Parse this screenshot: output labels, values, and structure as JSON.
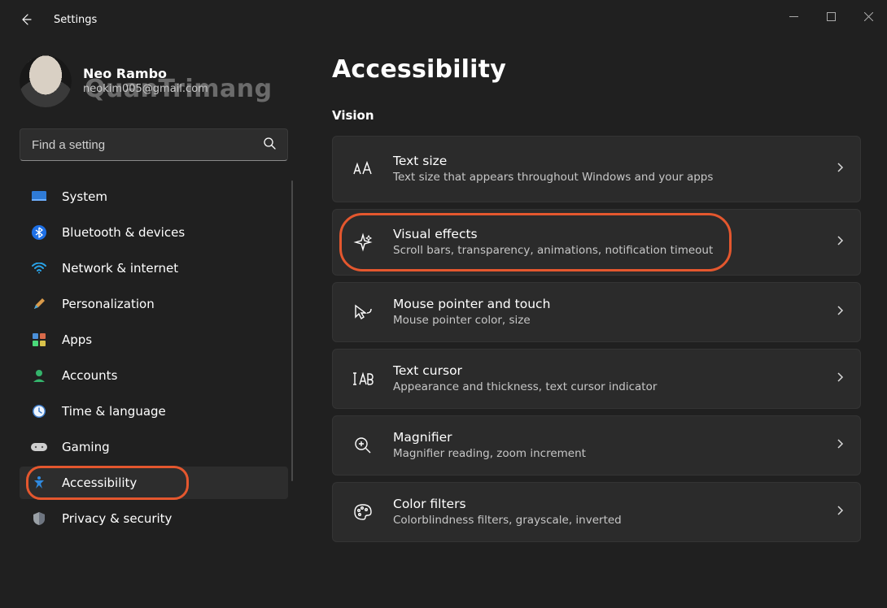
{
  "titlebar": {
    "app_title": "Settings"
  },
  "profile": {
    "name": "Neo Rambo",
    "email": "neokim005@gmail.com"
  },
  "watermark": "QuanTrimang",
  "search": {
    "placeholder": "Find a setting"
  },
  "sidebar": {
    "items": [
      {
        "icon": "monitor",
        "label": "System"
      },
      {
        "icon": "bluetooth",
        "label": "Bluetooth & devices"
      },
      {
        "icon": "wifi",
        "label": "Network & internet"
      },
      {
        "icon": "brush",
        "label": "Personalization"
      },
      {
        "icon": "apps",
        "label": "Apps"
      },
      {
        "icon": "person",
        "label": "Accounts"
      },
      {
        "icon": "clock",
        "label": "Time & language"
      },
      {
        "icon": "gamepad",
        "label": "Gaming"
      },
      {
        "icon": "accessibility",
        "label": "Accessibility",
        "active": true,
        "highlighted": true
      },
      {
        "icon": "shield",
        "label": "Privacy & security"
      }
    ]
  },
  "page": {
    "title": "Accessibility",
    "section": "Vision",
    "cards": [
      {
        "icon": "text-size",
        "title": "Text size",
        "sub": "Text size that appears throughout Windows and your apps"
      },
      {
        "icon": "sparkle",
        "title": "Visual effects",
        "sub": "Scroll bars, transparency, animations, notification timeout",
        "highlighted": true
      },
      {
        "icon": "cursor",
        "title": "Mouse pointer and touch",
        "sub": "Mouse pointer color, size"
      },
      {
        "icon": "text-cursor",
        "title": "Text cursor",
        "sub": "Appearance and thickness, text cursor indicator"
      },
      {
        "icon": "magnifier",
        "title": "Magnifier",
        "sub": "Magnifier reading, zoom increment"
      },
      {
        "icon": "palette",
        "title": "Color filters",
        "sub": "Colorblindness filters, grayscale, inverted"
      }
    ]
  },
  "highlight_color": "#e4572e"
}
